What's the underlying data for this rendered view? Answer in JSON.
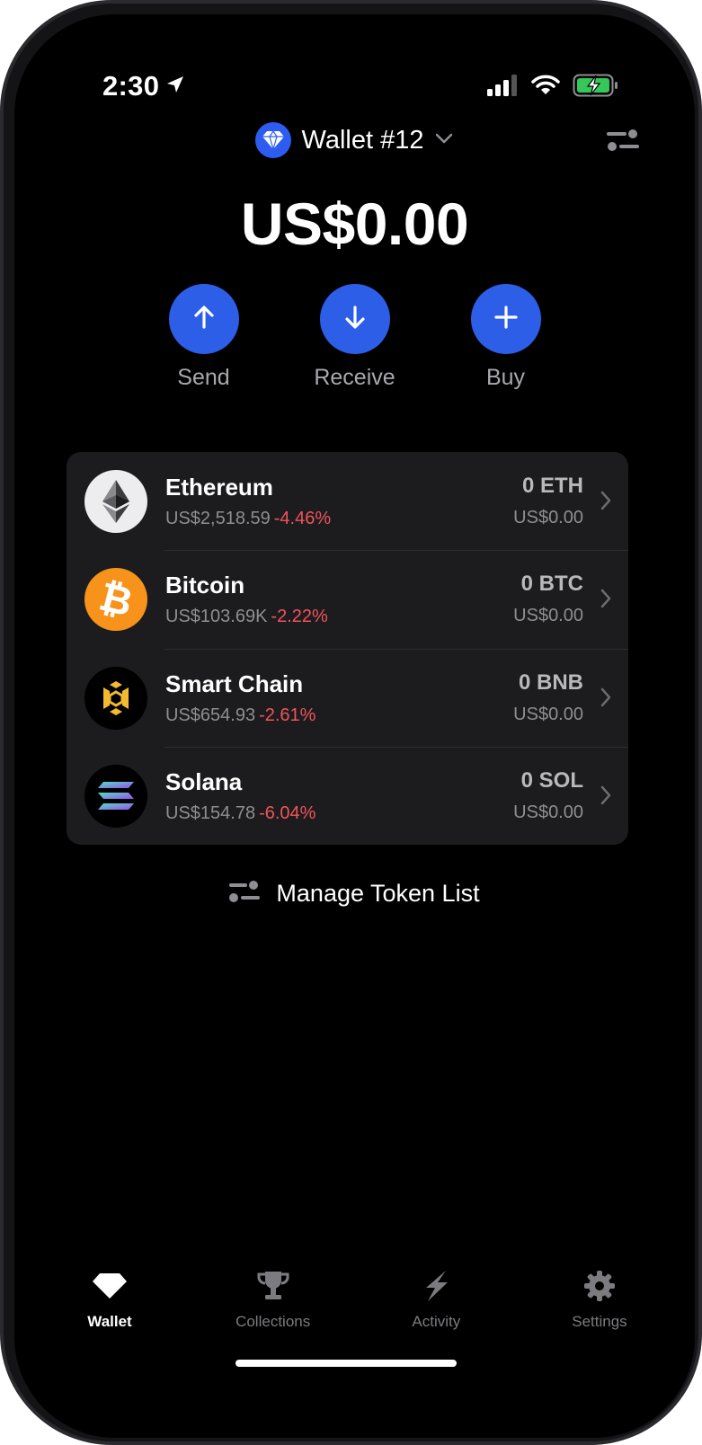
{
  "status_bar": {
    "time": "2:30"
  },
  "header": {
    "wallet_name": "Wallet #12"
  },
  "balance": "US$0.00",
  "actions": [
    {
      "label": "Send",
      "icon": "arrow-up-icon"
    },
    {
      "label": "Receive",
      "icon": "arrow-down-icon"
    },
    {
      "label": "Buy",
      "icon": "plus-icon"
    }
  ],
  "tokens": [
    {
      "name": "Ethereum",
      "price": "US$2,518.59",
      "change": "-4.46%",
      "amount": "0 ETH",
      "value": "US$0.00"
    },
    {
      "name": "Bitcoin",
      "price": "US$103.69K",
      "change": "-2.22%",
      "amount": "0 BTC",
      "value": "US$0.00"
    },
    {
      "name": "Smart Chain",
      "price": "US$654.93",
      "change": "-2.61%",
      "amount": "0 BNB",
      "value": "US$0.00"
    },
    {
      "name": "Solana",
      "price": "US$154.78",
      "change": "-6.04%",
      "amount": "0 SOL",
      "value": "US$0.00"
    }
  ],
  "manage_label": "Manage Token List",
  "tabs": [
    {
      "label": "Wallet",
      "active": true
    },
    {
      "label": "Collections",
      "active": false
    },
    {
      "label": "Activity",
      "active": false
    },
    {
      "label": "Settings",
      "active": false
    }
  ],
  "colors": {
    "accent": "#2c5ee8",
    "negative": "#f0545a",
    "card": "#1c1c1e",
    "background": "#000000"
  }
}
